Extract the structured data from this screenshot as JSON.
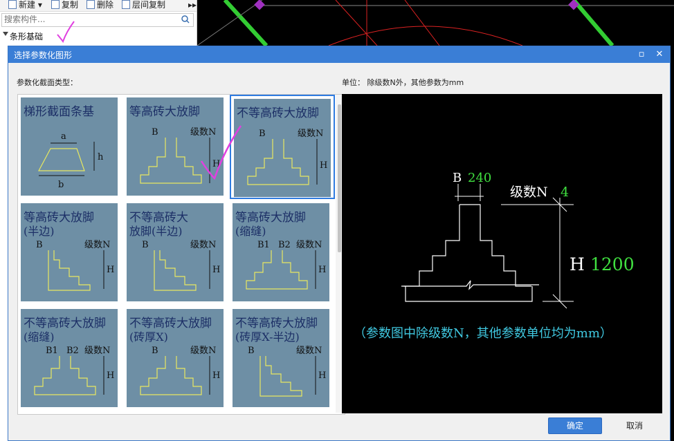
{
  "toolbar": {
    "new_label": "新建",
    "copy_label": "复制",
    "delete_label": "删除",
    "floor_copy_label": "层间复制"
  },
  "search": {
    "placeholder": "搜索构件..."
  },
  "tree": {
    "item_label": "条形基础"
  },
  "dialog": {
    "title": "选择参数化图形",
    "section_type_label": "参数化截面类型：",
    "unit_label": "单位：  除级数N外，其他参数为mm",
    "ok_label": "确定",
    "cancel_label": "取消"
  },
  "thumbnails": [
    {
      "title": "梯形截面条基",
      "labels": [
        "a",
        "h",
        "b"
      ]
    },
    {
      "title": "等高砖大放脚",
      "labels": [
        "B",
        "级数N",
        "H"
      ]
    },
    {
      "title": "不等高砖大放脚",
      "labels": [
        "B",
        "级数N",
        "H"
      ],
      "selected": true
    },
    {
      "title": "等高砖大放脚",
      "title2": "(半边)",
      "labels": [
        "B",
        "级数N",
        "H"
      ]
    },
    {
      "title": "不等高砖大",
      "title2": "放脚(半边)",
      "labels": [
        "B",
        "级数N",
        "H"
      ]
    },
    {
      "title": "等高砖大放脚",
      "title2": "(缩缝)",
      "labels": [
        "B1",
        "B2",
        "级数N",
        "H"
      ]
    },
    {
      "title": "不等高砖大放脚",
      "title2": "(缩缝)",
      "labels": [
        "B1",
        "B2",
        "级数N",
        "H"
      ]
    },
    {
      "title": "不等高砖大放脚",
      "title2": "(砖厚X)",
      "labels": [
        "B",
        "级数N",
        "H"
      ]
    },
    {
      "title": "不等高砖大放脚",
      "title2": "(砖厚X-半边)",
      "labels": [
        "B",
        "级数N",
        "H"
      ]
    }
  ],
  "preview": {
    "b_label": "B",
    "b_value": "240",
    "n_label": "级数N",
    "n_value": "4",
    "h_label": "H",
    "h_value": "1200",
    "note": "（参数图中除级数N，其他参数单位均为mm）"
  },
  "colors": {
    "accent": "#3a7ed6",
    "card": "#6e8fa5",
    "preview_value": "#40e040",
    "preview_note": "#40c8e0",
    "annotation": "#e040e0"
  }
}
